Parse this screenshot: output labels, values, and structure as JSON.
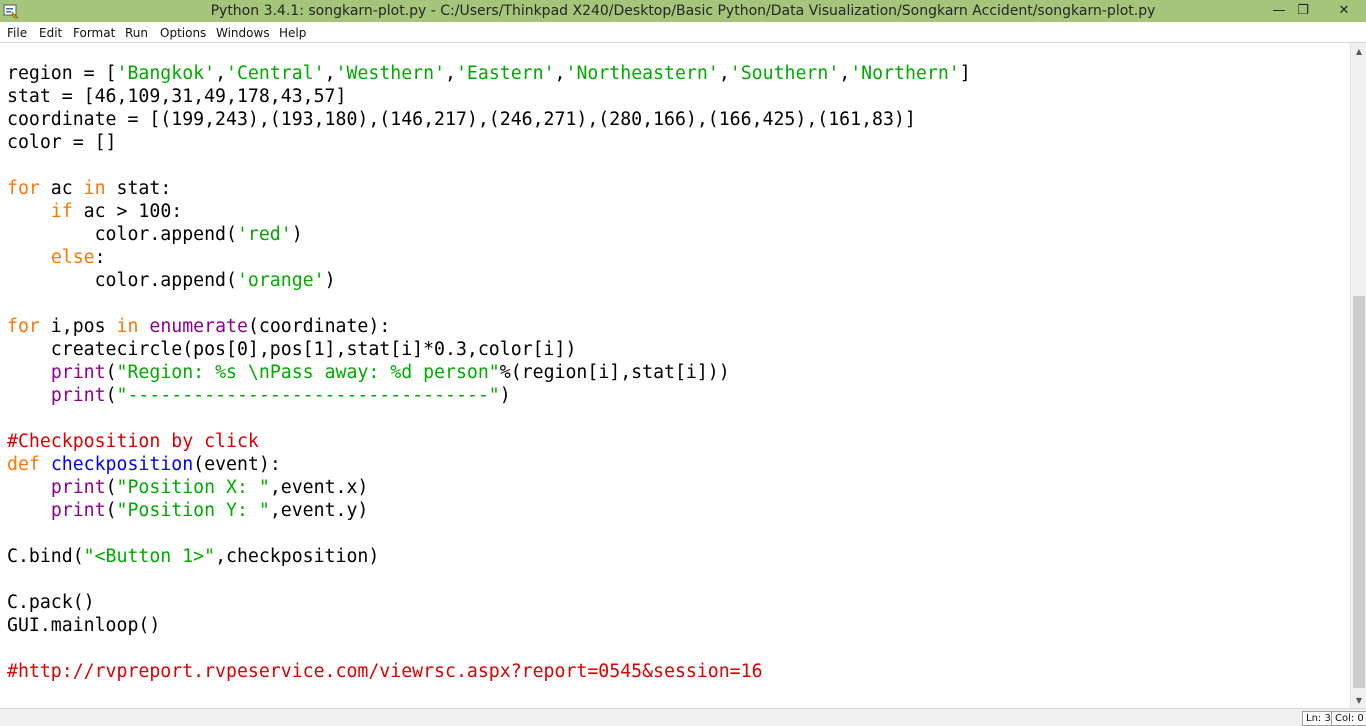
{
  "window": {
    "title": "Python 3.4.1: songkarn-plot.py - C:/Users/Thinkpad X240/Desktop/Basic Python/Data Visualization/Songkarn Accident/songkarn-plot.py",
    "app_icon": "python-idle-icon",
    "minimize_glyph": "—",
    "restore_glyph": "❐",
    "close_glyph": "✕"
  },
  "menu": [
    "File",
    "Edit",
    "Format",
    "Run",
    "Options",
    "Windows",
    "Help"
  ],
  "code_lines": [
    [
      {
        "t": "region = ["
      },
      {
        "t": "'Bangkok'",
        "c": "str"
      },
      {
        "t": ","
      },
      {
        "t": "'Central'",
        "c": "str"
      },
      {
        "t": ","
      },
      {
        "t": "'Westhern'",
        "c": "str"
      },
      {
        "t": ","
      },
      {
        "t": "'Eastern'",
        "c": "str"
      },
      {
        "t": ","
      },
      {
        "t": "'Northeastern'",
        "c": "str"
      },
      {
        "t": ","
      },
      {
        "t": "'Southern'",
        "c": "str"
      },
      {
        "t": ","
      },
      {
        "t": "'Northern'",
        "c": "str"
      },
      {
        "t": "]"
      }
    ],
    [
      {
        "t": "stat = [46,109,31,49,178,43,57]"
      }
    ],
    [
      {
        "t": "coordinate = [(199,243),(193,180),(146,217),(246,271),(280,166),(166,425),(161,83)]"
      }
    ],
    [
      {
        "t": "color = []"
      }
    ],
    [],
    [
      {
        "t": "for",
        "c": "kw"
      },
      {
        "t": " ac "
      },
      {
        "t": "in",
        "c": "kw"
      },
      {
        "t": " stat:"
      }
    ],
    [
      {
        "t": "    "
      },
      {
        "t": "if",
        "c": "kw"
      },
      {
        "t": " ac > 100:"
      }
    ],
    [
      {
        "t": "        color.append("
      },
      {
        "t": "'red'",
        "c": "str"
      },
      {
        "t": ")"
      }
    ],
    [
      {
        "t": "    "
      },
      {
        "t": "else",
        "c": "kw"
      },
      {
        "t": ":"
      }
    ],
    [
      {
        "t": "        color.append("
      },
      {
        "t": "'orange'",
        "c": "str"
      },
      {
        "t": ")"
      }
    ],
    [],
    [
      {
        "t": "for",
        "c": "kw"
      },
      {
        "t": " i,pos "
      },
      {
        "t": "in",
        "c": "kw"
      },
      {
        "t": " "
      },
      {
        "t": "enumerate",
        "c": "bi"
      },
      {
        "t": "(coordinate):"
      }
    ],
    [
      {
        "t": "    createcircle(pos[0],pos[1],stat[i]*0.3,color[i])"
      }
    ],
    [
      {
        "t": "    "
      },
      {
        "t": "print",
        "c": "bi"
      },
      {
        "t": "("
      },
      {
        "t": "\"Region: %s \\nPass away: %d person\"",
        "c": "str"
      },
      {
        "t": "%(region[i],stat[i]))"
      }
    ],
    [
      {
        "t": "    "
      },
      {
        "t": "print",
        "c": "bi"
      },
      {
        "t": "("
      },
      {
        "t": "\"---------------------------------\"",
        "c": "str"
      },
      {
        "t": ")"
      }
    ],
    [],
    [
      {
        "t": "#Checkposition by click",
        "c": "com"
      }
    ],
    [
      {
        "t": "def",
        "c": "kw"
      },
      {
        "t": " "
      },
      {
        "t": "checkposition",
        "c": "def"
      },
      {
        "t": "(event):"
      }
    ],
    [
      {
        "t": "    "
      },
      {
        "t": "print",
        "c": "bi"
      },
      {
        "t": "("
      },
      {
        "t": "\"Position X: \"",
        "c": "str"
      },
      {
        "t": ",event.x)"
      }
    ],
    [
      {
        "t": "    "
      },
      {
        "t": "print",
        "c": "bi"
      },
      {
        "t": "("
      },
      {
        "t": "\"Position Y: \"",
        "c": "str"
      },
      {
        "t": ",event.y)"
      }
    ],
    [],
    [
      {
        "t": "C.bind("
      },
      {
        "t": "\"<Button 1>\"",
        "c": "str"
      },
      {
        "t": ",checkposition)"
      }
    ],
    [],
    [
      {
        "t": "C.pack()"
      }
    ],
    [
      {
        "t": "GUI.mainloop()"
      }
    ],
    [],
    [
      {
        "t": "#http://rvpreport.rvpeservice.com/viewrsc.aspx?report=0545&session=16",
        "c": "com"
      }
    ]
  ],
  "status": {
    "line": "Ln: 3",
    "col": "Col: 0"
  },
  "scrollbar": {
    "up_icon": "scroll-up-arrow-icon",
    "down_icon": "scroll-down-arrow-icon"
  }
}
